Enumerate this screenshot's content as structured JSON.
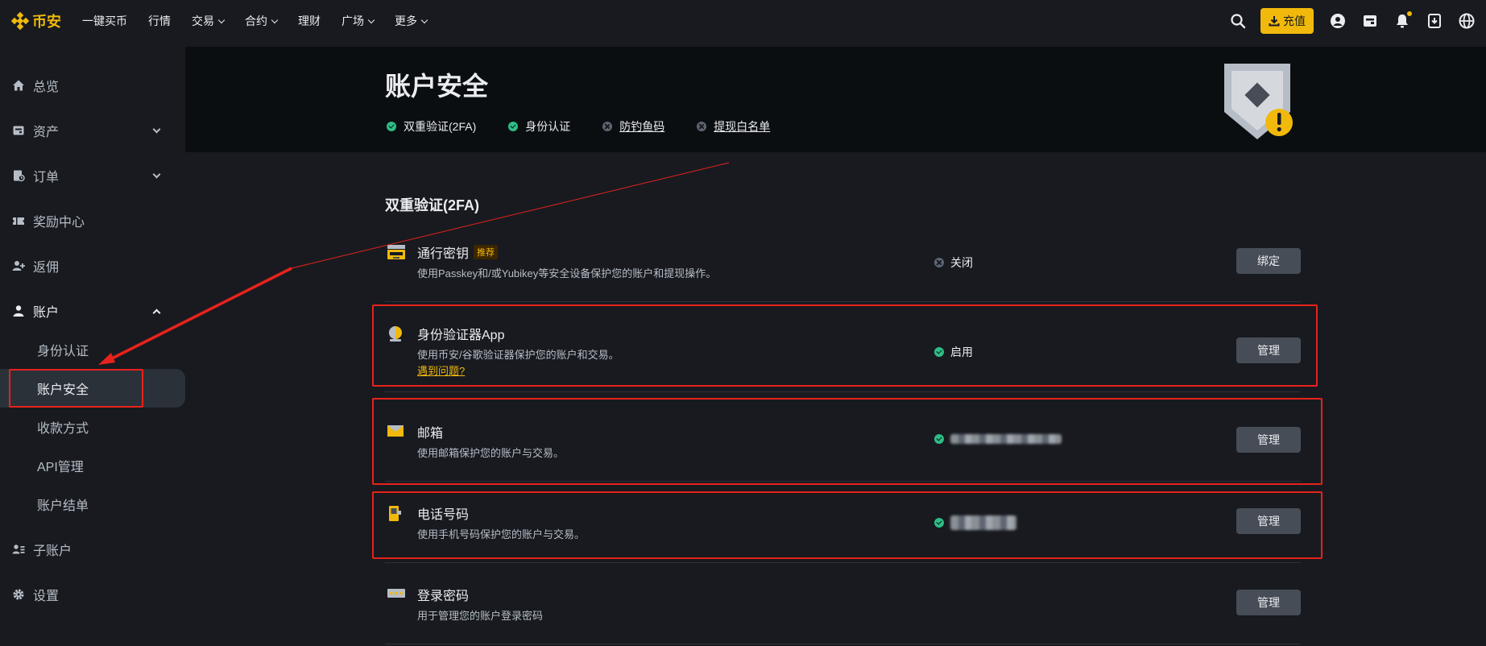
{
  "nav": {
    "brand": "币安",
    "items": [
      {
        "label": "一键买币",
        "dropdown": false
      },
      {
        "label": "行情",
        "dropdown": false
      },
      {
        "label": "交易",
        "dropdown": true
      },
      {
        "label": "合约",
        "dropdown": true
      },
      {
        "label": "理财",
        "dropdown": false
      },
      {
        "label": "广场",
        "dropdown": true
      },
      {
        "label": "更多",
        "dropdown": true
      }
    ],
    "deposit_label": "充值",
    "accent": "#f0b90b"
  },
  "sidebar": {
    "items": [
      {
        "label": "总览",
        "icon": "home-icon"
      },
      {
        "label": "资产",
        "icon": "wallet-icon"
      },
      {
        "label": "订单",
        "icon": "orders-icon"
      },
      {
        "label": "奖励中心",
        "icon": "ticket-icon"
      },
      {
        "label": "返佣",
        "icon": "referral-icon"
      },
      {
        "label": "账户",
        "icon": "user-icon"
      },
      {
        "label": "子账户",
        "icon": "sub-account-icon"
      },
      {
        "label": "设置",
        "icon": "gear-icon"
      }
    ],
    "account_sub": [
      "身份认证",
      "账户安全",
      "收款方式",
      "API管理",
      "账户结单"
    ],
    "selected": "账户安全"
  },
  "header": {
    "title": "账户安全",
    "status": [
      {
        "label": "双重验证(2FA)",
        "state": "ok"
      },
      {
        "label": "身份认证",
        "state": "ok"
      },
      {
        "label": "防钓鱼码",
        "state": "off"
      },
      {
        "label": "提现白名单",
        "state": "off"
      }
    ]
  },
  "twofa": {
    "section_title": "双重验证(2FA)",
    "rows": [
      {
        "title": "通行密钥",
        "badge": "推荐",
        "desc": "使用Passkey和/或Yubikey等安全设备保护您的账户和提现操作。",
        "status": "关闭",
        "state": "off",
        "button": "绑定",
        "icon": "passkey-icon"
      },
      {
        "title": "身份验证器App",
        "desc": "使用币安/谷歌验证器保护您的账户和交易。",
        "link": "遇到问题?",
        "status": "启用",
        "state": "ok",
        "button": "管理",
        "icon": "authenticator-icon"
      },
      {
        "title": "邮箱",
        "desc": "使用邮箱保护您的账户与交易。",
        "status": "",
        "state": "ok",
        "button": "管理",
        "icon": "email-icon"
      },
      {
        "title": "电话号码",
        "desc": "使用手机号码保护您的账户与交易。",
        "status": "",
        "state": "ok",
        "button": "管理",
        "icon": "phone-icon"
      },
      {
        "title": "登录密码",
        "desc": "用于管理您的账户登录密码",
        "button": "管理",
        "icon": "password-icon"
      }
    ]
  },
  "colors": {
    "background": "#181a20",
    "banner": "#0b0e11",
    "success": "#2ebd85",
    "annotation": "#e8221b"
  }
}
